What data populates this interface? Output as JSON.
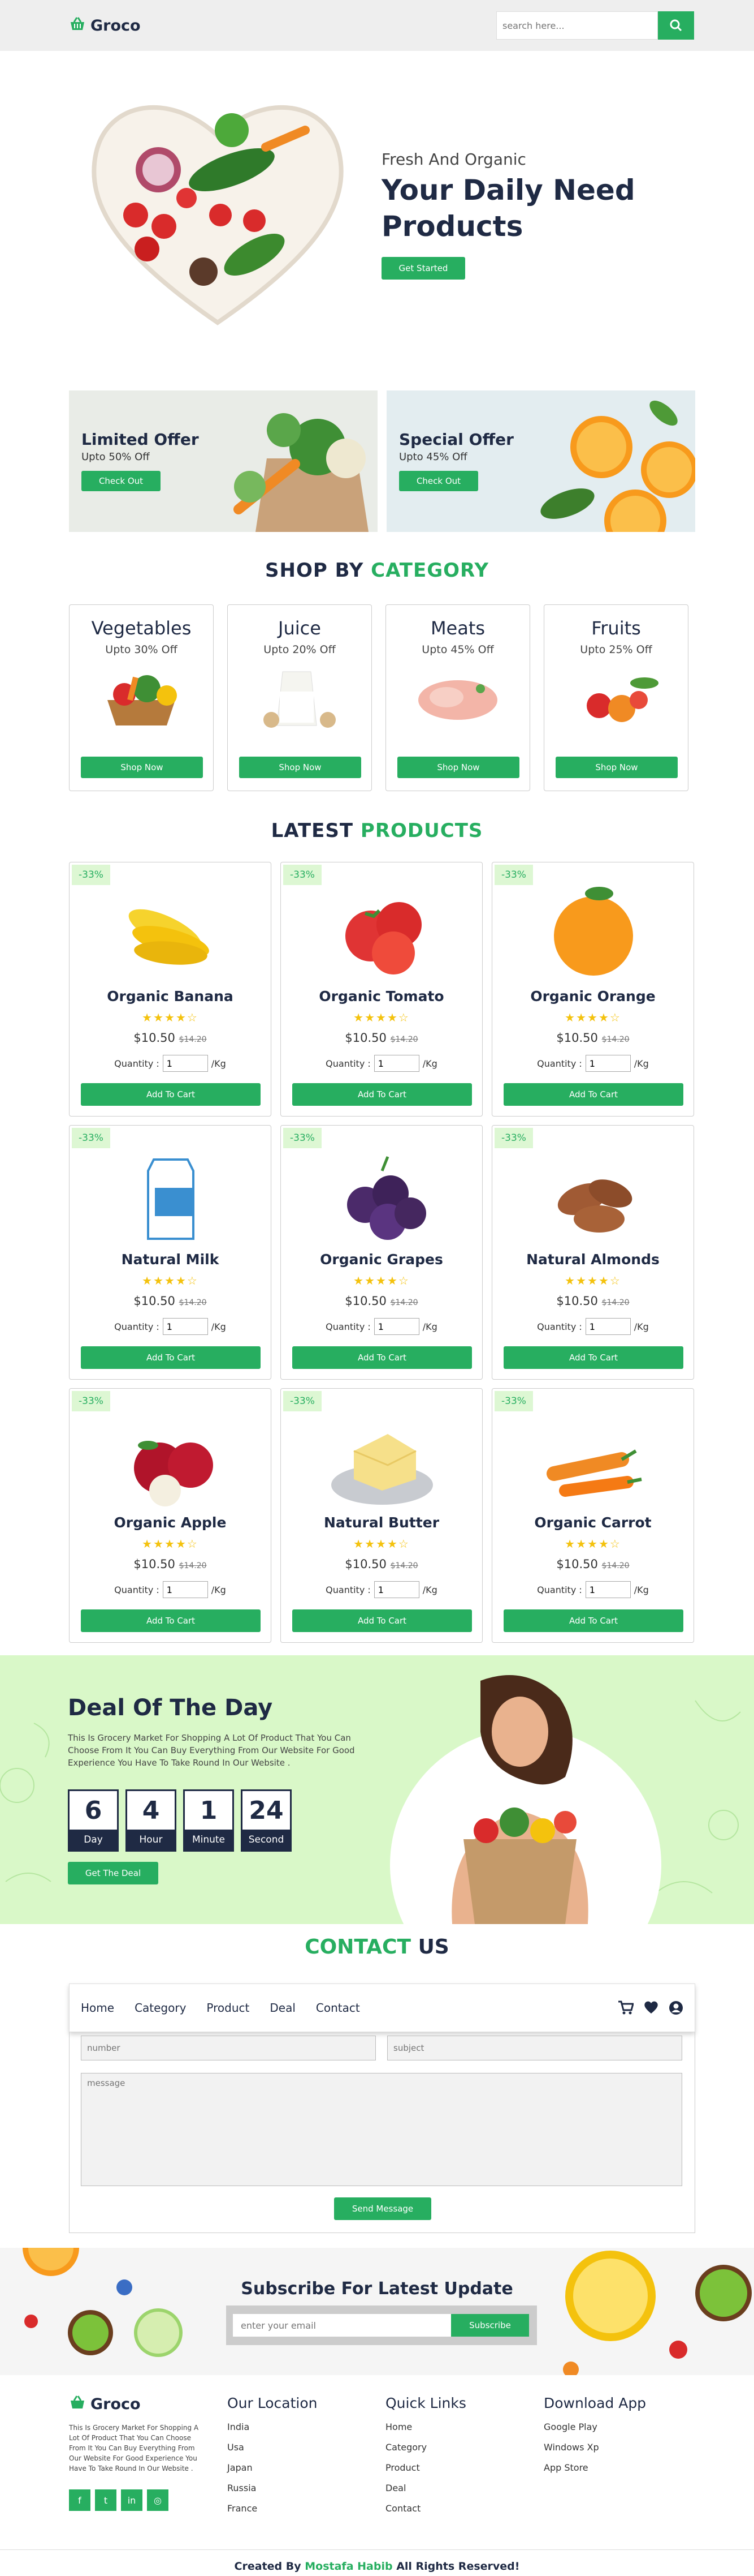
{
  "brand": {
    "name": "Groco",
    "accent": "#27ae60",
    "dark": "#1f2a44"
  },
  "header": {
    "search_placeholder": "search here..."
  },
  "hero": {
    "subtitle": "Fresh And Organic",
    "title_line1": "Your Daily Need",
    "title_line2": "Products",
    "button": "Get Started"
  },
  "offers": [
    {
      "title": "Limited Offer",
      "sub": "Upto 50% Off",
      "button": "Check Out"
    },
    {
      "title": "Special Offer",
      "sub": "Upto 45% Off",
      "button": "Check Out"
    }
  ],
  "category_section": {
    "title_a": "SHOP BY",
    "title_b": "CATEGORY"
  },
  "categories": [
    {
      "name": "Vegetables",
      "offer": "Upto 30% Off",
      "button": "Shop Now"
    },
    {
      "name": "Juice",
      "offer": "Upto 20% Off",
      "button": "Shop Now"
    },
    {
      "name": "Meats",
      "offer": "Upto 45% Off",
      "button": "Shop Now"
    },
    {
      "name": "Fruits",
      "offer": "Upto 25% Off",
      "button": "Shop Now"
    }
  ],
  "products_section": {
    "title_a": "LATEST",
    "title_b": "PRODUCTS"
  },
  "product_common": {
    "discount": "-33%",
    "stars": "★★★★☆",
    "price": "$10.50",
    "old_price": "$14.20",
    "qty_label": "Quantity :",
    "qty_value": "1",
    "unit": "/Kg",
    "button": "Add To Cart"
  },
  "products": [
    {
      "name": "Organic Banana"
    },
    {
      "name": "Organic Tomato"
    },
    {
      "name": "Organic Orange"
    },
    {
      "name": "Natural Milk"
    },
    {
      "name": "Organic Grapes"
    },
    {
      "name": "Natural Almonds"
    },
    {
      "name": "Organic Apple"
    },
    {
      "name": "Natural Butter"
    },
    {
      "name": "Organic Carrot"
    }
  ],
  "deal": {
    "title": "Deal Of The Day",
    "text": "This Is Grocery Market For Shopping A Lot Of Product That You Can Choose From It You Can Buy Everything From Our Website For Good Experience You Have To Take Round In Our Website .",
    "button": "Get The Deal",
    "countdown": [
      {
        "n": "6",
        "l": "Day"
      },
      {
        "n": "4",
        "l": "Hour"
      },
      {
        "n": "1",
        "l": "Minute"
      },
      {
        "n": "24",
        "l": "Second"
      }
    ]
  },
  "contact": {
    "title_a": "CONTACT",
    "title_b": "US",
    "number_ph": "number",
    "subject_ph": "subject",
    "message_ph": "message",
    "button": "Send Message"
  },
  "nav": {
    "links": [
      "Home",
      "Category",
      "Product",
      "Deal",
      "Contact"
    ]
  },
  "subscribe": {
    "title": "Subscribe For Latest Update",
    "placeholder": "enter your email",
    "button": "Subscribe"
  },
  "footer": {
    "about": "This Is Grocery Market For Shopping A Lot Of Product That You Can Choose From It You Can Buy Everything From Our Website For Good Experience You Have To Take Round In Our Website .",
    "location_title": "Our Location",
    "locations": [
      "India",
      "Usa",
      "Japan",
      "Russia",
      "France"
    ],
    "links_title": "Quick Links",
    "links": [
      "Home",
      "Category",
      "Product",
      "Deal",
      "Contact"
    ],
    "app_title": "Download App",
    "apps": [
      "Google Play",
      "Windows Xp",
      "App Store"
    ],
    "copy_a": "Created By",
    "copy_author": "Mostafa Habib",
    "copy_b": "All Rights Reserved!"
  }
}
